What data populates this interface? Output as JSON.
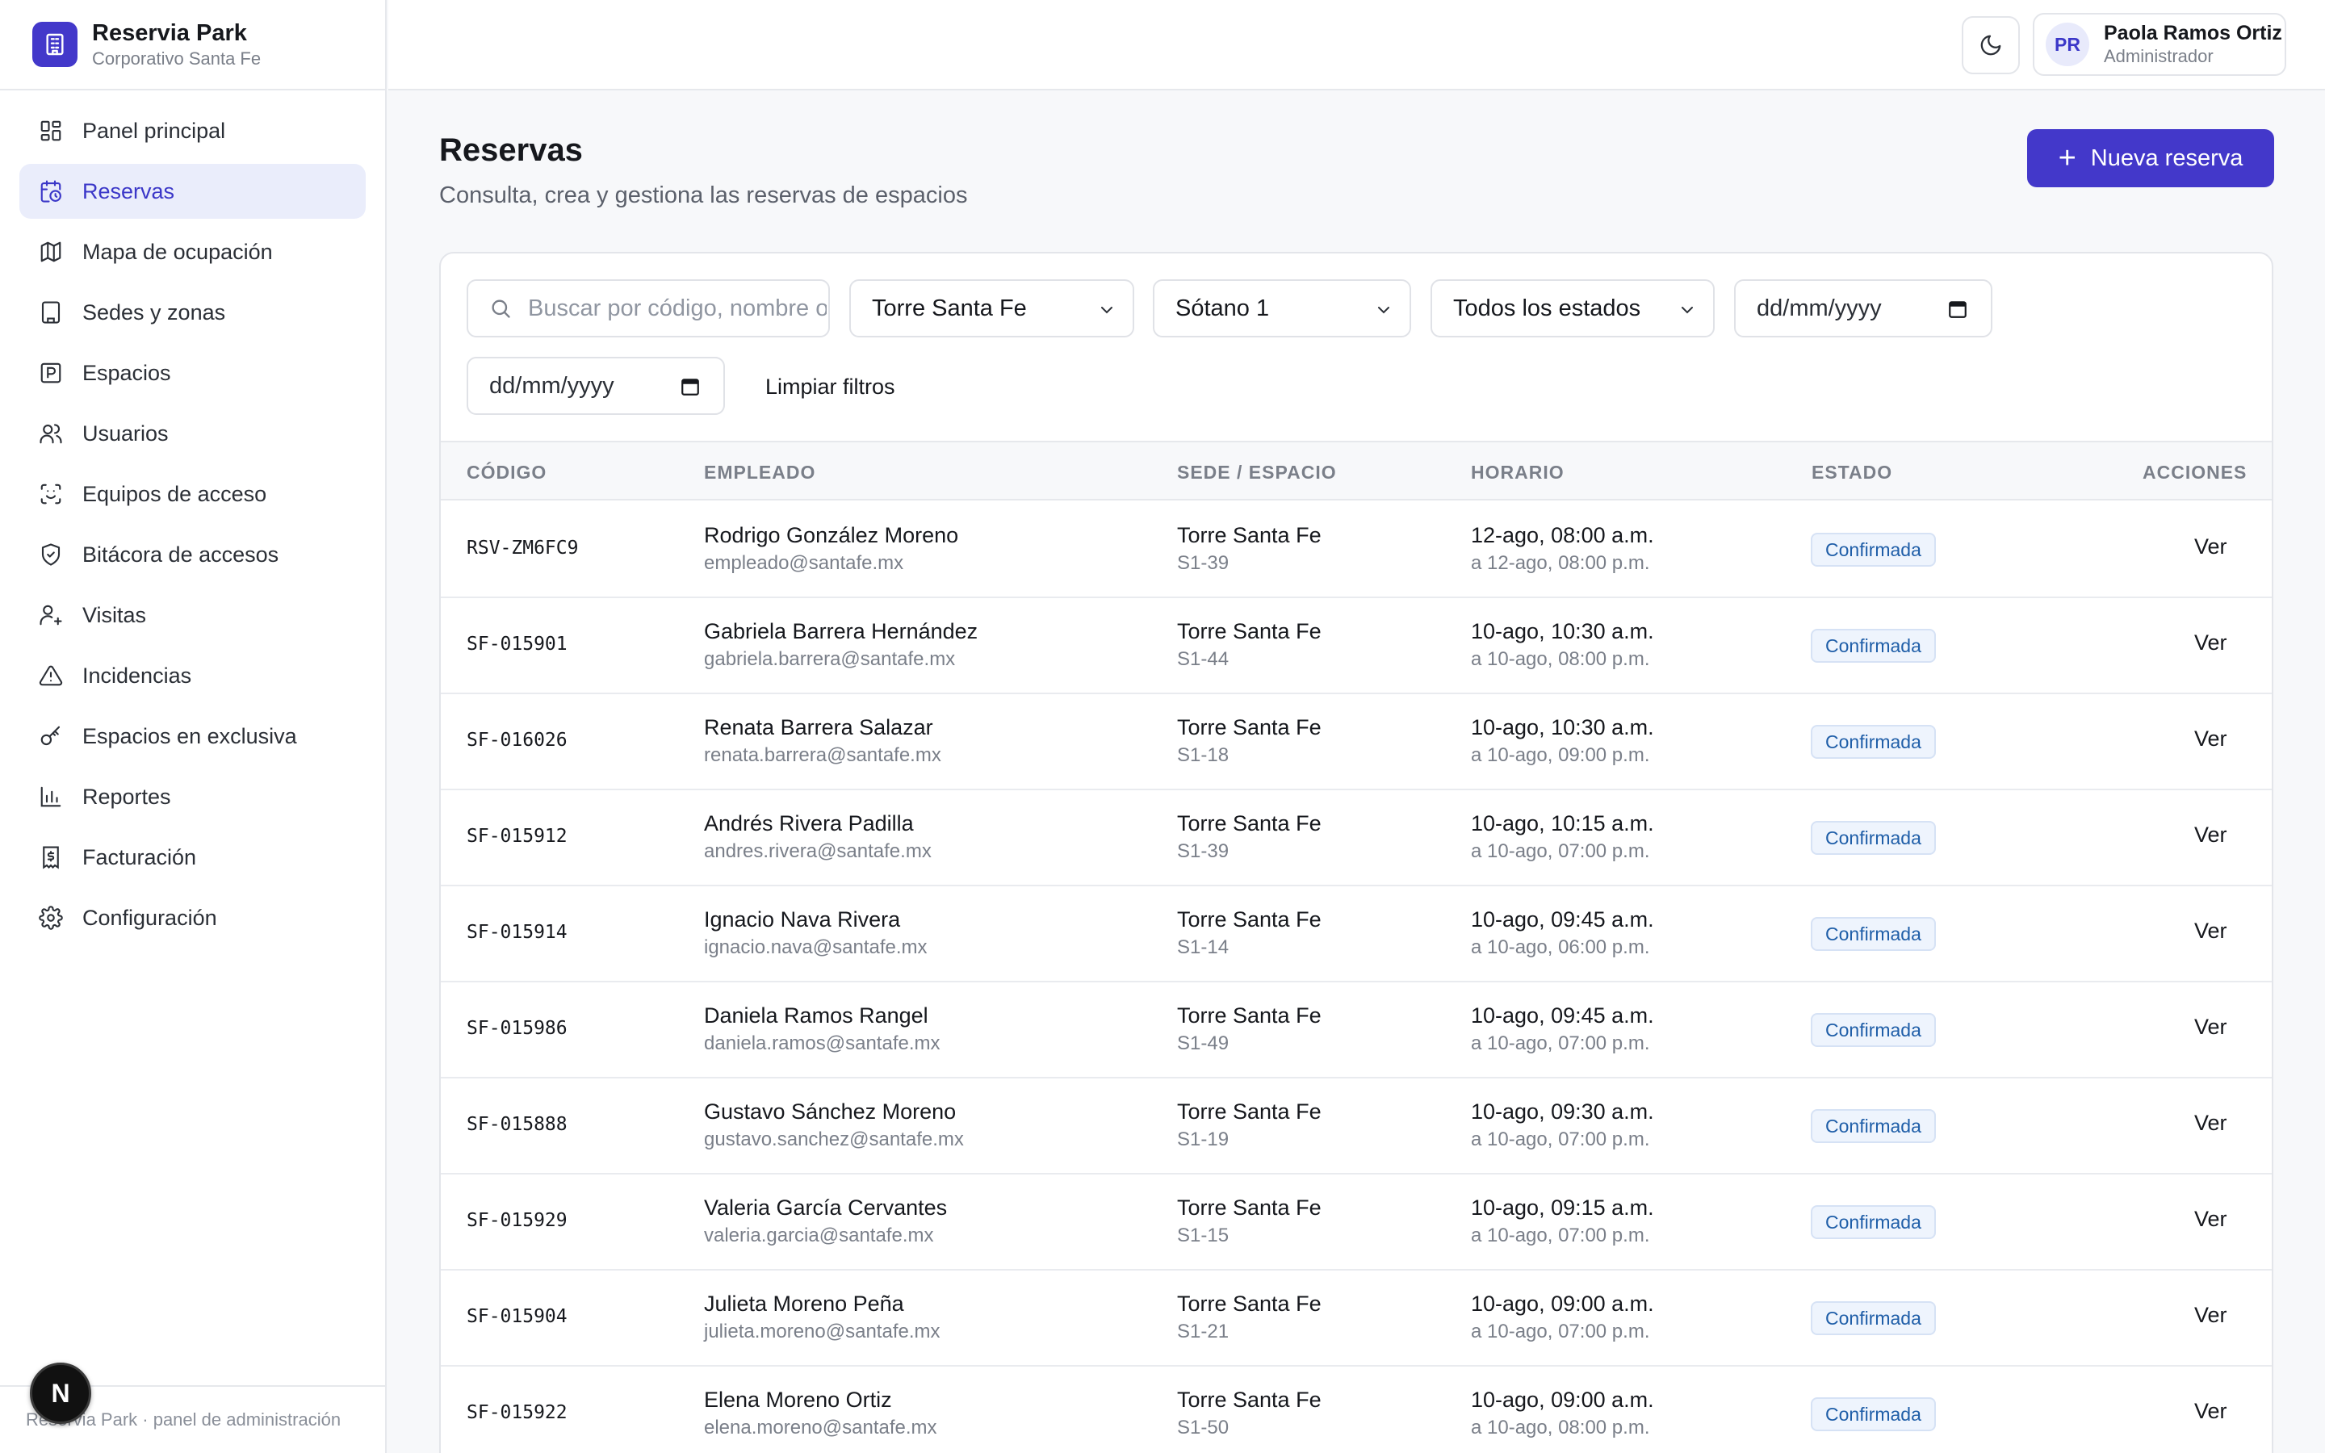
{
  "brand": {
    "title": "Reservia Park",
    "subtitle": "Corporativo Santa Fe"
  },
  "sidebar": {
    "items": [
      {
        "label": "Panel principal",
        "icon": "dashboard-icon",
        "active": false
      },
      {
        "label": "Reservas",
        "icon": "calendar-clock-icon",
        "active": true
      },
      {
        "label": "Mapa de ocupación",
        "icon": "map-icon",
        "active": false
      },
      {
        "label": "Sedes y zonas",
        "icon": "building-icon",
        "active": false
      },
      {
        "label": "Espacios",
        "icon": "parking-icon",
        "active": false
      },
      {
        "label": "Usuarios",
        "icon": "users-icon",
        "active": false
      },
      {
        "label": "Equipos de acceso",
        "icon": "scan-icon",
        "active": false
      },
      {
        "label": "Bitácora de accesos",
        "icon": "shield-icon",
        "active": false
      },
      {
        "label": "Visitas",
        "icon": "user-plus-icon",
        "active": false
      },
      {
        "label": "Incidencias",
        "icon": "alert-icon",
        "active": false
      },
      {
        "label": "Espacios en exclusiva",
        "icon": "key-icon",
        "active": false
      },
      {
        "label": "Reportes",
        "icon": "bar-chart-icon",
        "active": false
      },
      {
        "label": "Facturación",
        "icon": "receipt-icon",
        "active": false
      },
      {
        "label": "Configuración",
        "icon": "gear-icon",
        "active": false
      }
    ],
    "footer": "Reservia Park · panel de administración",
    "badge": "N"
  },
  "topbar": {
    "user": {
      "initials": "PR",
      "name": "Paola Ramos Ortiz",
      "role": "Administrador"
    }
  },
  "header": {
    "title": "Reservas",
    "subtitle": "Consulta, crea y gestiona las reservas de espacios",
    "new_button": "Nueva reserva"
  },
  "filters": {
    "search_placeholder": "Buscar por código, nombre o correo",
    "site": "Torre Santa Fe",
    "level": "Sótano 1",
    "status": "Todos los estados",
    "date_from": "dd/mm/yyyy",
    "date_to": "dd/mm/yyyy",
    "clear": "Limpiar filtros"
  },
  "table": {
    "columns": [
      "CÓDIGO",
      "EMPLEADO",
      "SEDE / ESPACIO",
      "HORARIO",
      "ESTADO",
      "ACCIONES"
    ],
    "action_label": "Ver",
    "rows": [
      {
        "code": "RSV-ZM6FC9",
        "name": "Rodrigo González Moreno",
        "email": "empleado@santafe.mx",
        "site": "Torre Santa Fe",
        "space": "S1-39",
        "start": "12-ago, 08:00 a.m.",
        "end": "a 12-ago, 08:00 p.m.",
        "status": "Confirmada"
      },
      {
        "code": "SF-015901",
        "name": "Gabriela Barrera Hernández",
        "email": "gabriela.barrera@santafe.mx",
        "site": "Torre Santa Fe",
        "space": "S1-44",
        "start": "10-ago, 10:30 a.m.",
        "end": "a 10-ago, 08:00 p.m.",
        "status": "Confirmada"
      },
      {
        "code": "SF-016026",
        "name": "Renata Barrera Salazar",
        "email": "renata.barrera@santafe.mx",
        "site": "Torre Santa Fe",
        "space": "S1-18",
        "start": "10-ago, 10:30 a.m.",
        "end": "a 10-ago, 09:00 p.m.",
        "status": "Confirmada"
      },
      {
        "code": "SF-015912",
        "name": "Andrés Rivera Padilla",
        "email": "andres.rivera@santafe.mx",
        "site": "Torre Santa Fe",
        "space": "S1-39",
        "start": "10-ago, 10:15 a.m.",
        "end": "a 10-ago, 07:00 p.m.",
        "status": "Confirmada"
      },
      {
        "code": "SF-015914",
        "name": "Ignacio Nava Rivera",
        "email": "ignacio.nava@santafe.mx",
        "site": "Torre Santa Fe",
        "space": "S1-14",
        "start": "10-ago, 09:45 a.m.",
        "end": "a 10-ago, 06:00 p.m.",
        "status": "Confirmada"
      },
      {
        "code": "SF-015986",
        "name": "Daniela Ramos Rangel",
        "email": "daniela.ramos@santafe.mx",
        "site": "Torre Santa Fe",
        "space": "S1-49",
        "start": "10-ago, 09:45 a.m.",
        "end": "a 10-ago, 07:00 p.m.",
        "status": "Confirmada"
      },
      {
        "code": "SF-015888",
        "name": "Gustavo Sánchez Moreno",
        "email": "gustavo.sanchez@santafe.mx",
        "site": "Torre Santa Fe",
        "space": "S1-19",
        "start": "10-ago, 09:30 a.m.",
        "end": "a 10-ago, 07:00 p.m.",
        "status": "Confirmada"
      },
      {
        "code": "SF-015929",
        "name": "Valeria García Cervantes",
        "email": "valeria.garcia@santafe.mx",
        "site": "Torre Santa Fe",
        "space": "S1-15",
        "start": "10-ago, 09:15 a.m.",
        "end": "a 10-ago, 07:00 p.m.",
        "status": "Confirmada"
      },
      {
        "code": "SF-015904",
        "name": "Julieta Moreno Peña",
        "email": "julieta.moreno@santafe.mx",
        "site": "Torre Santa Fe",
        "space": "S1-21",
        "start": "10-ago, 09:00 a.m.",
        "end": "a 10-ago, 07:00 p.m.",
        "status": "Confirmada"
      },
      {
        "code": "SF-015922",
        "name": "Elena Moreno Ortiz",
        "email": "elena.moreno@santafe.mx",
        "site": "Torre Santa Fe",
        "space": "S1-50",
        "start": "10-ago, 09:00 a.m.",
        "end": "a 10-ago, 08:00 p.m.",
        "status": "Confirmada"
      }
    ]
  },
  "colors": {
    "accent": "#4338ca",
    "active_nav_bg": "#eaedfb",
    "status_confirmed": "#1f5ea8"
  }
}
